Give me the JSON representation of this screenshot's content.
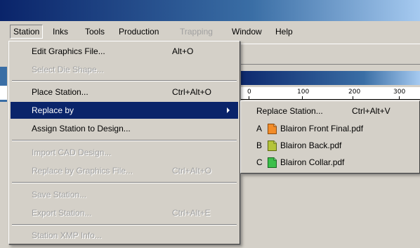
{
  "menubar": {
    "items": [
      {
        "label": "Station",
        "state": "active"
      },
      {
        "label": "Inks",
        "state": "normal"
      },
      {
        "label": "Tools",
        "state": "normal"
      },
      {
        "label": "Production",
        "state": "normal"
      },
      {
        "label": "Trapping",
        "state": "disabled"
      },
      {
        "label": "Window",
        "state": "normal"
      },
      {
        "label": "Help",
        "state": "normal"
      }
    ]
  },
  "ruler": {
    "ticks": [
      "0",
      "100",
      "200",
      "300"
    ]
  },
  "station_menu": {
    "items": [
      {
        "label": "Edit Graphics File...",
        "shortcut": "Alt+O"
      },
      {
        "label": "Select Die Shape..."
      },
      {
        "label": "Place Station...",
        "shortcut": "Ctrl+Alt+O"
      },
      {
        "label": "Replace by"
      },
      {
        "label": "Assign Station to Design..."
      },
      {
        "label": "Import CAD Design..."
      },
      {
        "label": "Replace by Graphics File...",
        "shortcut": "Ctrl+Alt+O"
      },
      {
        "label": "Save Station..."
      },
      {
        "label": "Export Station...",
        "shortcut": "Ctrl+Alt+E"
      },
      {
        "label": "Station XMP Info..."
      }
    ]
  },
  "replace_submenu": {
    "replace_station": {
      "label": "Replace Station...",
      "shortcut": "Ctrl+Alt+V"
    },
    "files": [
      {
        "key": "A",
        "name": "Blairon Front Final.pdf",
        "icon": "pdf-file-icon",
        "color": "#f28c28"
      },
      {
        "key": "B",
        "name": "Blairon Back.pdf",
        "icon": "pdf-file-icon",
        "color": "#b5c43a"
      },
      {
        "key": "C",
        "name": "Blairon Collar.pdf",
        "icon": "pdf-file-icon",
        "color": "#3cbf4a"
      }
    ]
  }
}
